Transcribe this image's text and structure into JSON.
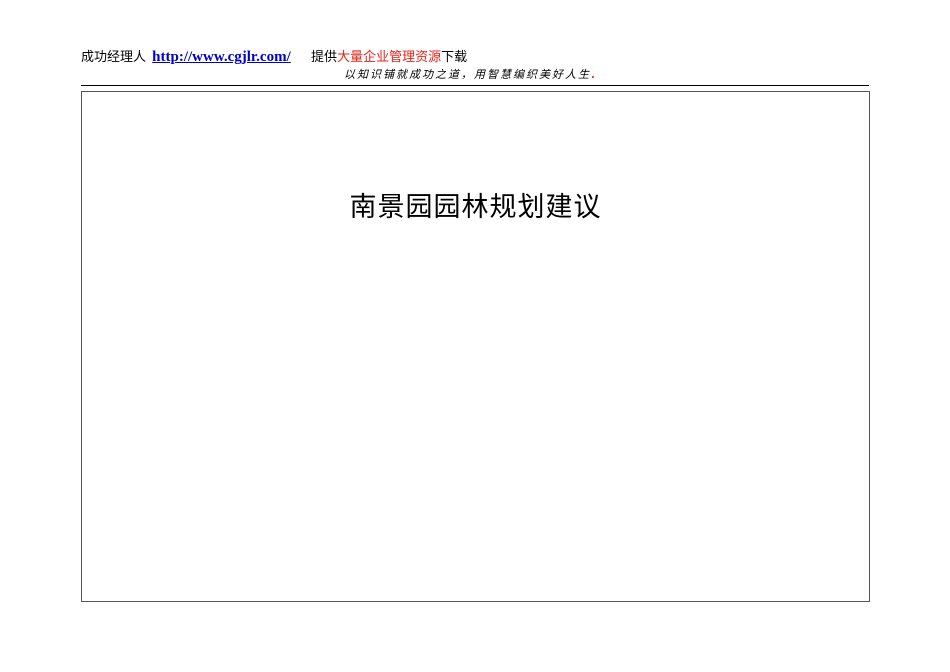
{
  "header": {
    "site_name": "成功经理人",
    "url": "http://www.cgjlr.com/",
    "provide_prefix": "提供",
    "provide_highlight": "大量企业管理资源",
    "provide_suffix": "下载",
    "tagline": "以知识铺就成功之道，用智慧编织美好人生",
    "tagline_end": ".",
    "highlight_color": "#e8231b",
    "link_color": "#0000cc"
  },
  "document": {
    "title": "南景园园林规划建议"
  }
}
